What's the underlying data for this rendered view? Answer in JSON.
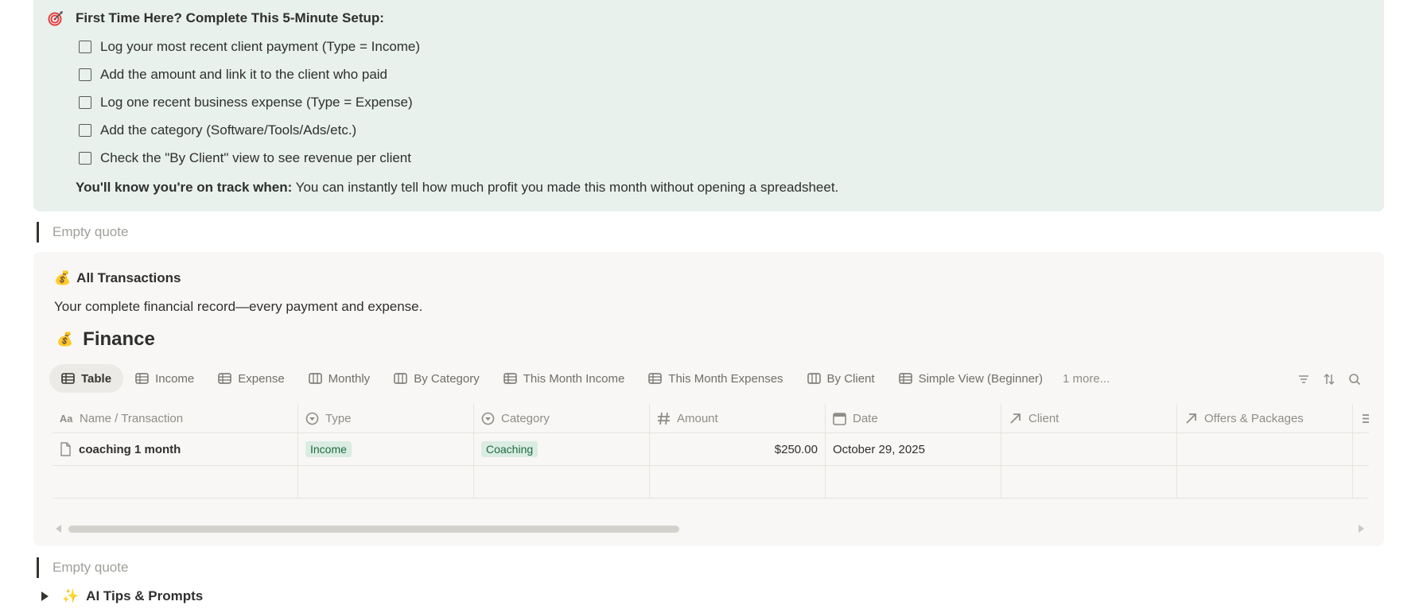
{
  "setup": {
    "title": "First Time Here? Complete This 5-Minute Setup:",
    "icon": "target-icon",
    "todos": [
      "Log your most recent client payment (Type = Income)",
      "Add the amount and link it to the client who paid",
      "Log one recent business expense (Type = Expense)",
      "Add the category (Software/Tools/Ads/etc.)",
      "Check the \"By Client\" view to see revenue per client"
    ],
    "ontrack_bold": "You'll know you're on track when:",
    "ontrack_text": " You can instantly tell how much profit you made this month without opening a spreadsheet."
  },
  "quotes": [
    "Empty quote",
    "Empty quote"
  ],
  "transactions": {
    "section_icon": "💰",
    "section_title": "All Transactions",
    "description": "Your complete financial record—every payment and expense.",
    "db_icon": "💰",
    "db_title": "Finance"
  },
  "tabs": [
    {
      "label": "Table",
      "icon": "table-icon",
      "active": true
    },
    {
      "label": "Income",
      "icon": "table-icon"
    },
    {
      "label": "Expense",
      "icon": "table-icon"
    },
    {
      "label": "Monthly",
      "icon": "board-icon"
    },
    {
      "label": "By Category",
      "icon": "board-icon"
    },
    {
      "label": "This Month Income",
      "icon": "table-icon"
    },
    {
      "label": "This Month Expenses",
      "icon": "table-icon"
    },
    {
      "label": "By Client",
      "icon": "board-icon"
    },
    {
      "label": "Simple View (Beginner)",
      "icon": "table-icon"
    }
  ],
  "more_tabs": "1 more...",
  "columns": [
    {
      "label": "Name / Transaction",
      "icon": "text-icon"
    },
    {
      "label": "Type",
      "icon": "select-icon"
    },
    {
      "label": "Category",
      "icon": "select-icon"
    },
    {
      "label": "Amount",
      "icon": "number-icon"
    },
    {
      "label": "Date",
      "icon": "calendar-icon"
    },
    {
      "label": "Client",
      "icon": "relation-icon"
    },
    {
      "label": "Offers & Packages",
      "icon": "relation-icon"
    }
  ],
  "rows": [
    {
      "name": "coaching 1 month",
      "type": "Income",
      "category": "Coaching",
      "amount": "$250.00",
      "date": "October 29, 2025",
      "client": "",
      "offers": ""
    }
  ],
  "toggle": {
    "icon": "✨",
    "label": "AI Tips & Prompts"
  },
  "colors": {
    "callout_bg": "#e8f1ec",
    "db_bg": "#f8f7f5",
    "tag_bg": "#dbece2",
    "tag_text": "#1f6a40",
    "target_red": "#e03e3e"
  }
}
